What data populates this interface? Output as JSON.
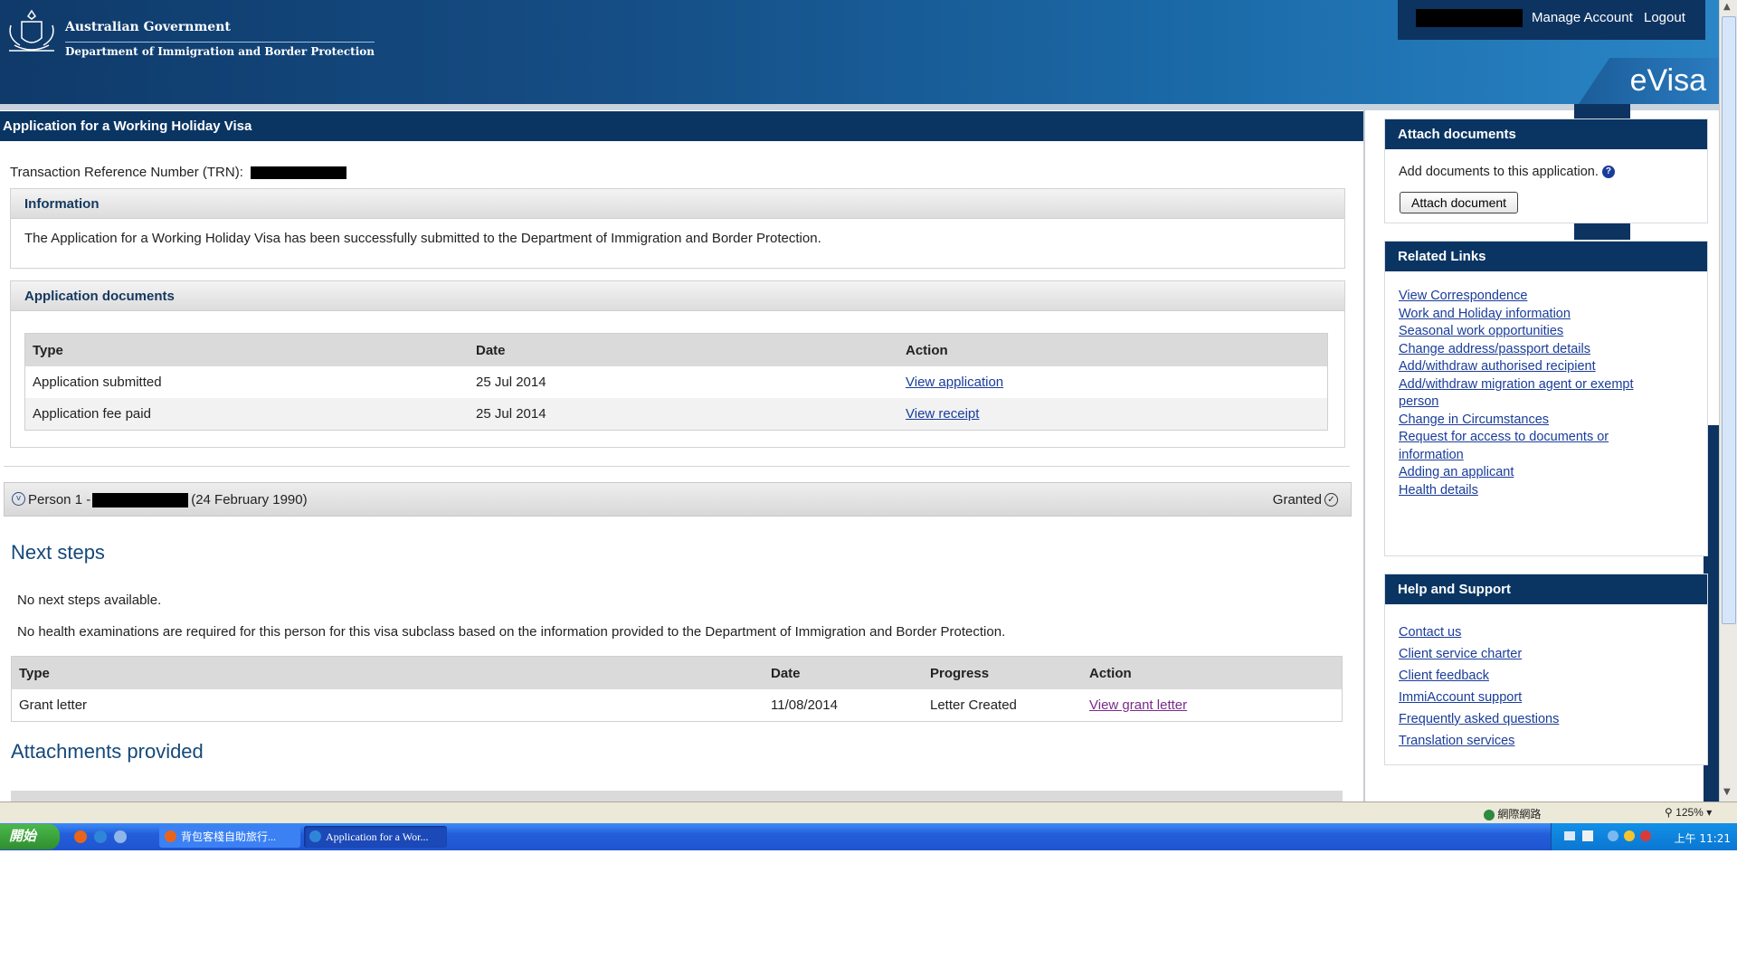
{
  "header": {
    "gov_line1": "Australian Government",
    "gov_line2": "Department of Immigration and Border Protection",
    "manage_account": "Manage Account",
    "logout": "Logout",
    "product": "eVisa"
  },
  "main": {
    "title": "Application for a Working Holiday Visa",
    "trn_label": "Transaction Reference Number (TRN):",
    "information": {
      "heading": "Information",
      "message": "The Application for a Working Holiday Visa has been successfully submitted to the Department of Immigration and Border Protection."
    },
    "documents": {
      "heading": "Application documents",
      "columns": [
        "Type",
        "Date",
        "Action"
      ],
      "rows": [
        {
          "type": "Application submitted",
          "date": "25 Jul 2014",
          "action": "View application"
        },
        {
          "type": "Application fee paid",
          "date": "25 Jul 2014",
          "action": "View receipt"
        }
      ]
    },
    "person": {
      "prefix": "Person 1 -",
      "dob": "(24 February 1990)",
      "status": "Granted"
    },
    "next_steps": {
      "heading": "Next steps",
      "no_steps": "No next steps available.",
      "health": "No health examinations are required for this person for this visa subclass based on the information provided to the Department of Immigration and Border Protection.",
      "columns": [
        "Type",
        "Date",
        "Progress",
        "Action"
      ],
      "rows": [
        {
          "type": "Grant letter",
          "date": "11/08/2014",
          "progress": "Letter Created",
          "action": "View grant letter"
        }
      ]
    },
    "attachments_heading": "Attachments provided"
  },
  "sidebar": {
    "attach": {
      "heading": "Attach documents",
      "text": "Add documents to this application.",
      "button": "Attach document"
    },
    "related": {
      "heading": "Related Links",
      "links": [
        "View Correspondence",
        "Work and Holiday information",
        "Seasonal work opportunities",
        "Change address/passport details",
        "Add/withdraw authorised recipient",
        "Add/withdraw migration agent or exempt person",
        "Change in Circumstances",
        "Request for access to documents or information",
        "Adding an applicant",
        "Health details"
      ]
    },
    "help": {
      "heading": "Help and Support",
      "links": [
        "Contact us",
        "Client service charter",
        "Client feedback",
        "ImmiAccount support",
        "Frequently asked questions",
        "Translation services"
      ]
    }
  },
  "statusbar": {
    "zone": "網際網路",
    "zoom": "125%"
  },
  "taskbar": {
    "start": "開始",
    "task1": "背包客棧自助旅行...",
    "task2": "Application for a Wor...",
    "clock": "上午 11:21"
  },
  "colors": {
    "header_dark": "#0a3563",
    "link": "#1a3d9a",
    "visited_link": "#7a2a8a",
    "heading_blue": "#15497a"
  }
}
